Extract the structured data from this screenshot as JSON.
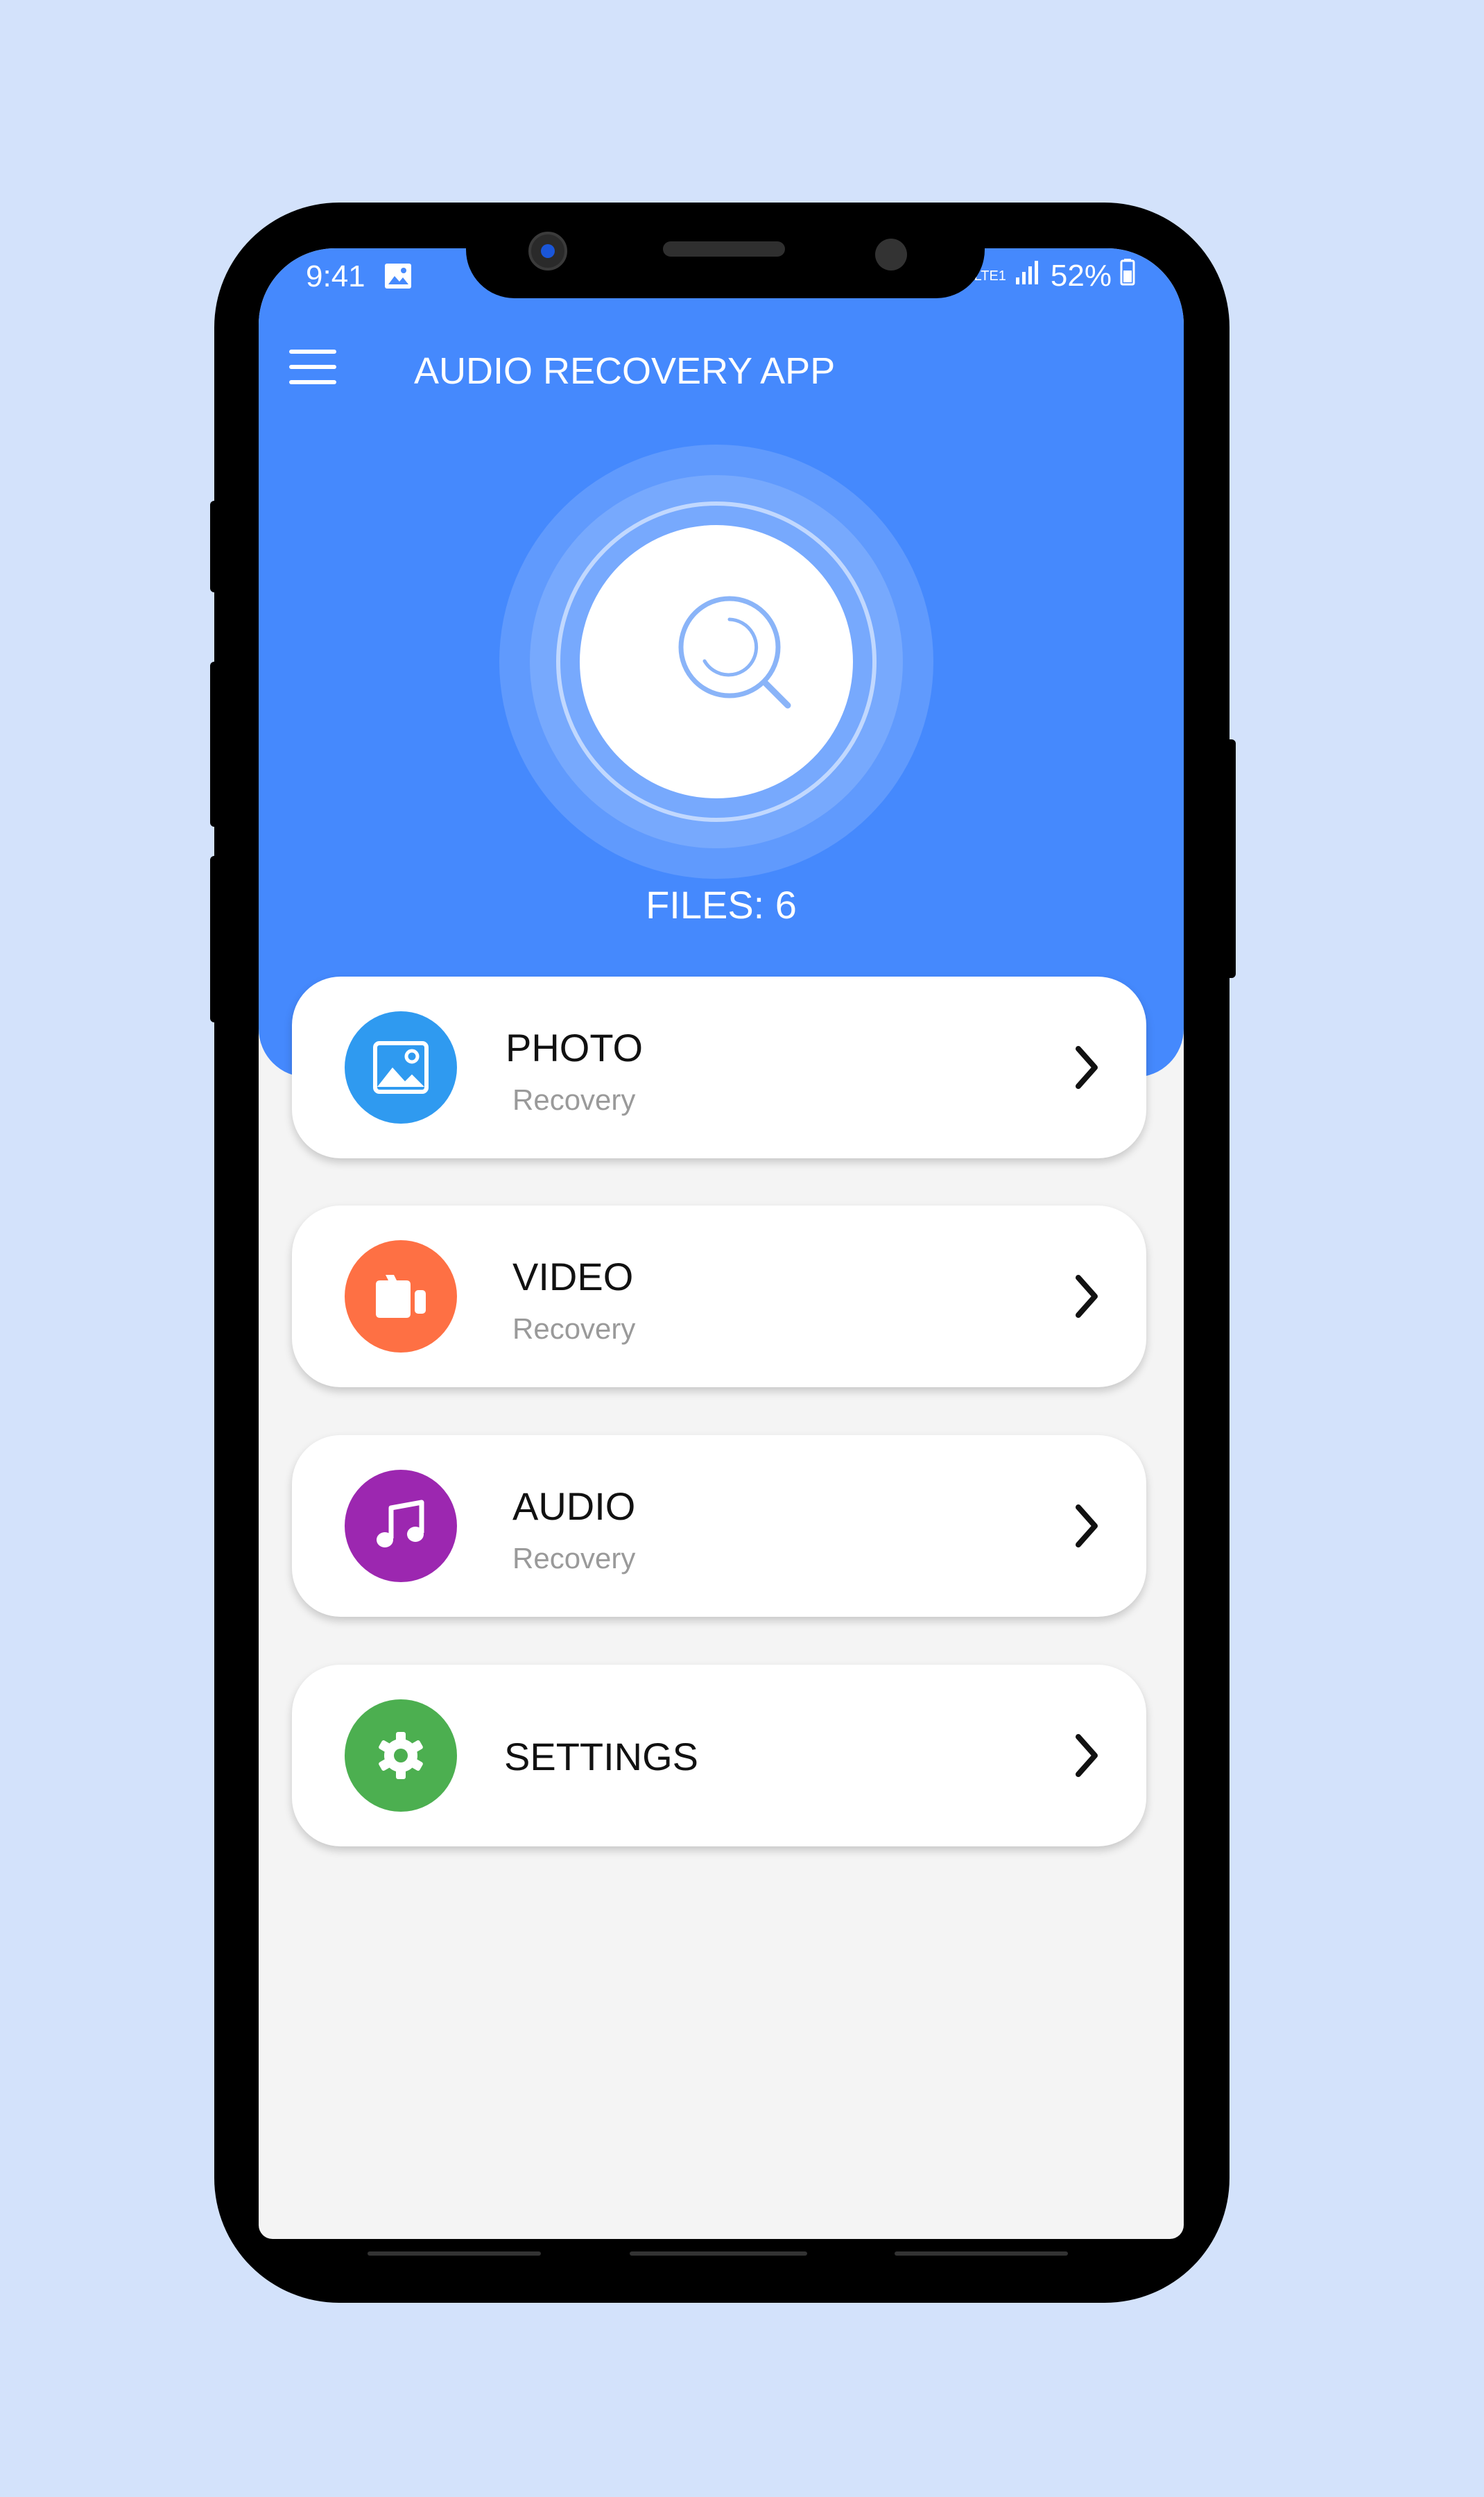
{
  "status_bar": {
    "time": "9:41",
    "network_label": "LTE1",
    "battery": "52%"
  },
  "app": {
    "title": "AUDIO RECOVERY APP",
    "files_label": "FILES: 6"
  },
  "colors": {
    "header": "#4589fd",
    "photo": "#2f9af0",
    "video": "#fe7044",
    "audio": "#9c27b0",
    "settings": "#4caf50"
  },
  "menu": [
    {
      "title": "PHOTO",
      "subtitle": "Recovery",
      "icon": "image-icon"
    },
    {
      "title": "VIDEO",
      "subtitle": "Recovery",
      "icon": "video-icon"
    },
    {
      "title": "AUDIO",
      "subtitle": "Recovery",
      "icon": "music-note-icon"
    },
    {
      "title": "SETTINGS",
      "icon": "gear-icon"
    }
  ]
}
